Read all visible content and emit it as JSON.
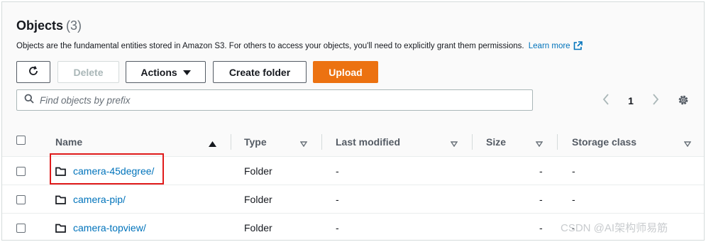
{
  "header": {
    "title": "Objects",
    "count": "(3)",
    "description": "Objects are the fundamental entities stored in Amazon S3. For others to access your objects, you'll need to explicitly grant them permissions.",
    "learn_more": "Learn more"
  },
  "toolbar": {
    "refresh_icon": "refresh-icon",
    "delete_label": "Delete",
    "actions_label": "Actions",
    "create_folder_label": "Create folder",
    "upload_label": "Upload",
    "upload_color": "#ec7211"
  },
  "search": {
    "placeholder": "Find objects by prefix"
  },
  "pagination": {
    "current_page": "1"
  },
  "table": {
    "columns": [
      "Name",
      "Type",
      "Last modified",
      "Size",
      "Storage class"
    ],
    "rows": [
      {
        "name": "camera-45degree/",
        "type": "Folder",
        "last_modified": "-",
        "size": "-",
        "storage_class": "-"
      },
      {
        "name": "camera-pip/",
        "type": "Folder",
        "last_modified": "-",
        "size": "-",
        "storage_class": "-"
      },
      {
        "name": "camera-topview/",
        "type": "Folder",
        "last_modified": "-",
        "size": "-",
        "storage_class": "-"
      }
    ]
  },
  "watermark": "CSDN @AI架构师易筋",
  "colors": {
    "link": "#0073bb",
    "highlight": "#e01b1b"
  }
}
